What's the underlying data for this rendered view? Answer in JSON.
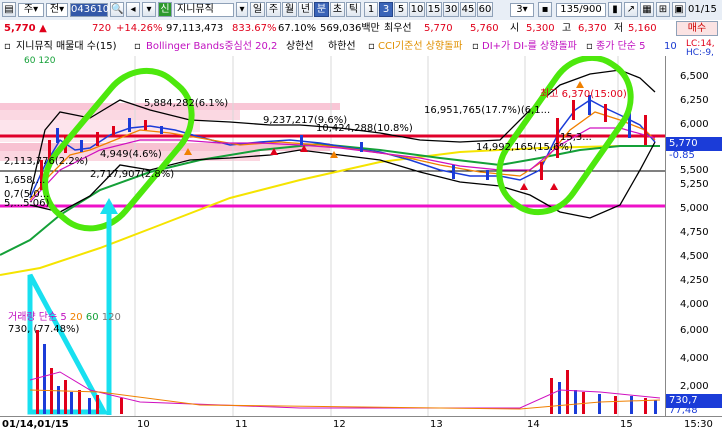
{
  "toolbar": {
    "market": "주",
    "prev": "전",
    "code": "043610",
    "stock_name": "지니뮤직",
    "period_buttons": [
      "일",
      "주",
      "월",
      "년",
      "분",
      "초",
      "틱"
    ],
    "minute_buttons": [
      "1",
      "3",
      "5",
      "10",
      "15",
      "30",
      "45",
      "60"
    ],
    "selected_minute": "3",
    "interval_value": "3",
    "count": "135/900",
    "date": "01/15"
  },
  "quote": {
    "price": "5,770",
    "change": "720",
    "change_pct": "+14.26%",
    "volume": "97,113,473",
    "vol_ratio": "833.67%",
    "turnover_pct": "67.10%",
    "amount": "569,036백만",
    "priority_label": "최우선",
    "ask": "5,770",
    "bid": "5,760",
    "low_label": "시",
    "open": "5,300",
    "high_label": "고",
    "high": "6,370",
    "low2_label": "저",
    "low": "5,160",
    "buy_label": "매수"
  },
  "legend": {
    "title": "지니뮤직 매물대 수(15)",
    "bollinger": "Bollinger Bands중심선 20,2",
    "upper": "상한선",
    "lower": "하한선",
    "cci": "CCI기준선 상향돌파",
    "dmi": "DI+가 DI-를 상향돌파",
    "ma": "종가 단순 5",
    "ma2": "10",
    "ma_sub": "60  120",
    "lc": "LC:14,",
    "hc": "HC:-9,"
  },
  "annotations": {
    "a1": "5,884,282(6.1%)",
    "a2": "9,237,217(9.6%)",
    "a3": "10,424,288(10.8%)",
    "a4": "16,951,765(17.7%)(6,1...",
    "a5": "2,113,776(2.2%)",
    "a6": "4,949(4.6%)",
    "a7": "2,717,907(2.8%)",
    "a8": "14,992,165(15.6%)",
    "a9": "15,3...",
    "a10": "1,658,...",
    "a11": "0,7(5.0...",
    "a12": "5,...5:06)",
    "high_note": "최고 6,370(15:00)",
    "last_price": "5,770",
    "last_change": "-0.85"
  },
  "volume_legend": {
    "label": "거래량 단순 5",
    "ma20": "20",
    "ma60": "60",
    "ma120": "120",
    "value": "730,",
    "pct": "(77.48%)"
  },
  "yaxis": [
    "6,500",
    "6,250",
    "6,000",
    "5,750",
    "5,500",
    "5,250",
    "5,000",
    "4,750",
    "4,500",
    "4,250",
    "4,000"
  ],
  "vol_axis": [
    "6,000",
    "4,000",
    "2,000"
  ],
  "vol_last": "730,7",
  "vol_pct2": "77,48",
  "xaxis": [
    "01/14,01/15",
    "10",
    "11",
    "12",
    "13",
    "14",
    "15",
    "15:30"
  ]
}
